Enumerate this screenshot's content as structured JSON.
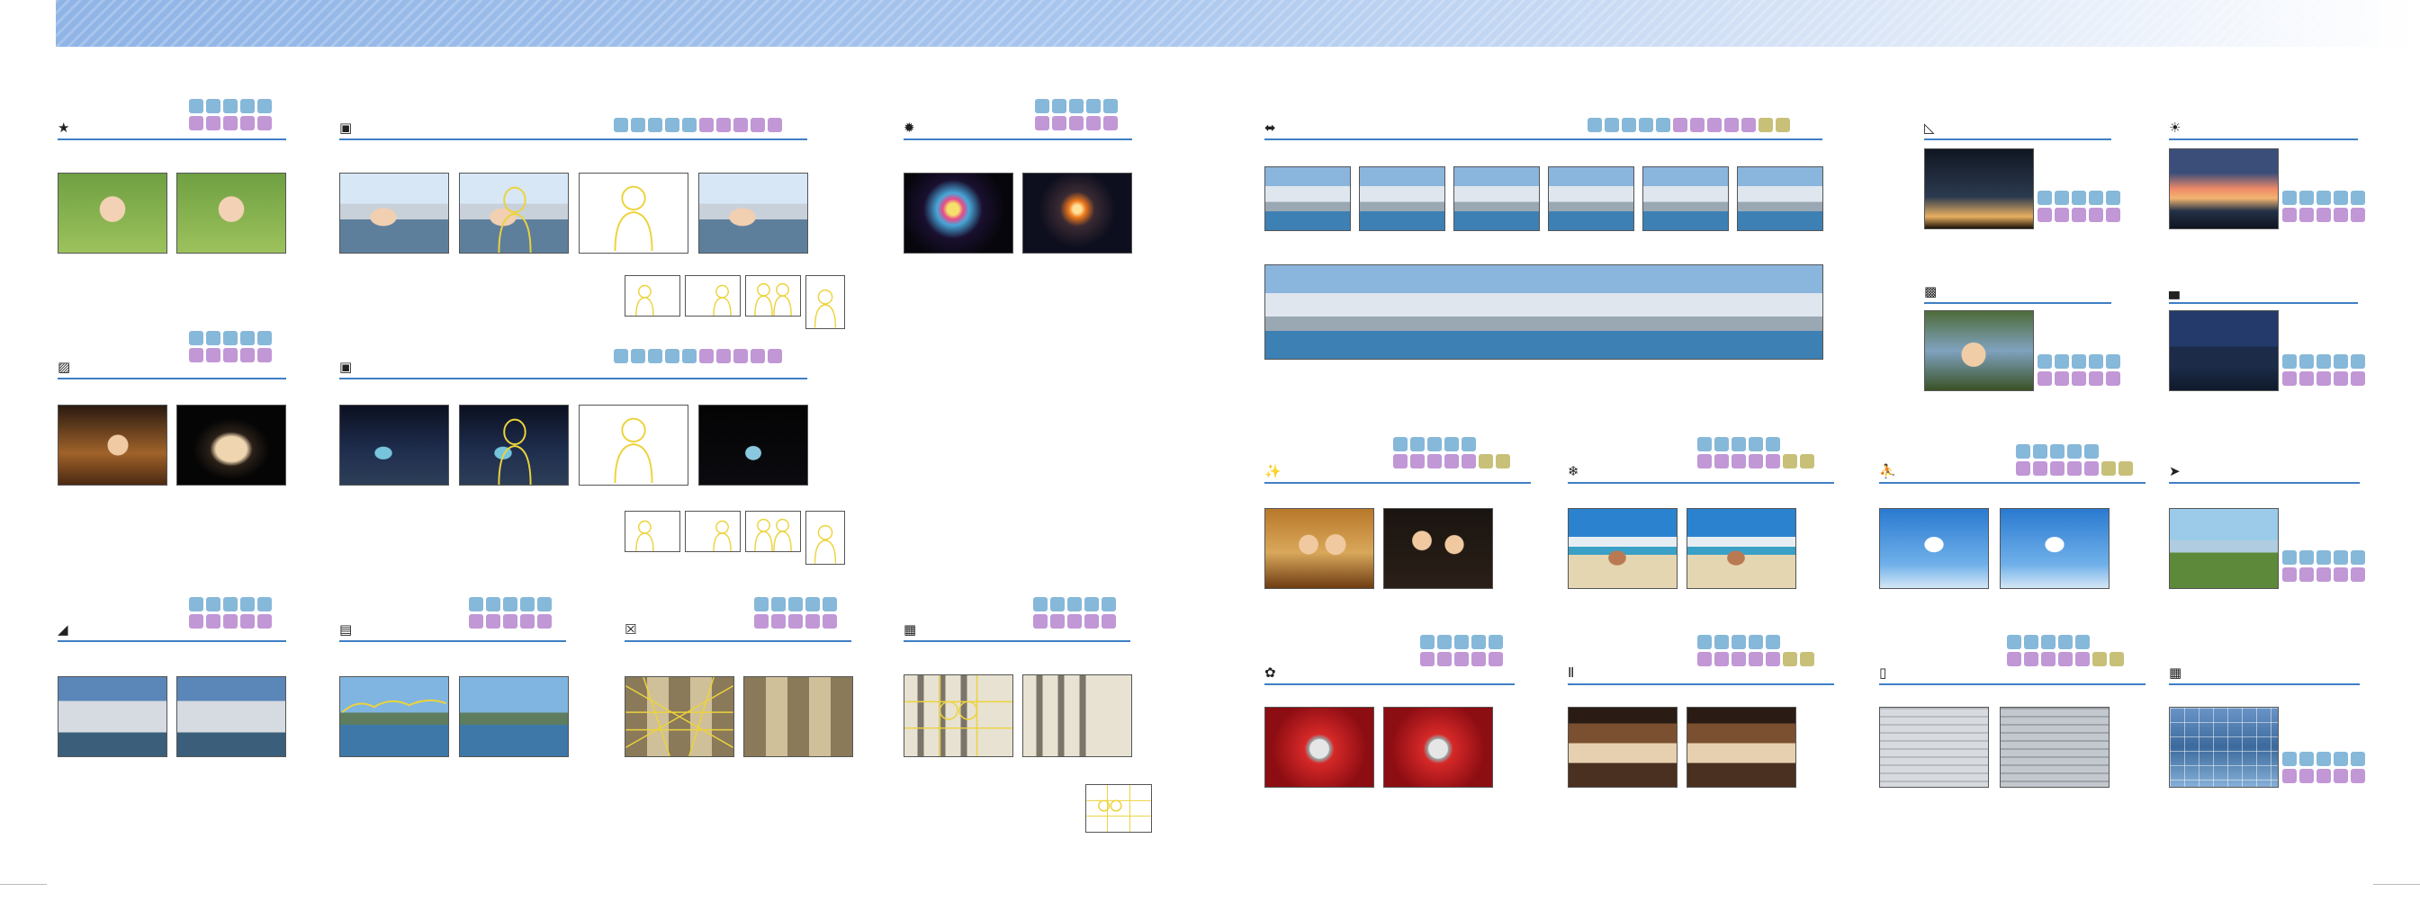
{
  "colors": {
    "accent": "#3f7fc4",
    "blue": "#86b8d9",
    "purple": "#c197d6",
    "olive": "#c8c078",
    "outline": "#ecd33c"
  },
  "icons": {
    "s1": "child-running-icon",
    "s2": "portrait-camera-icon",
    "s3": "fireworks-icon",
    "s4": "night-portrait-icon",
    "s5": "night-portrait-tripod-icon",
    "s6": "landscape-icon",
    "s7": "horizon-icon",
    "s8": "architecture-icon",
    "s9": "group-photo-icon",
    "s10": "panorama-icon",
    "s11": "night-landscape-icon",
    "s12": "sunset-icon",
    "s13": "backlight-icon",
    "s14": "dusk-icon",
    "s15": "party-icon",
    "s16": "beach-snow-icon",
    "s17": "sports-icon",
    "s18": "sports-action-icon",
    "s19": "close-up-icon",
    "s20": "museum-icon",
    "s21": "copy-document-icon",
    "s22": "multi-frame-icon"
  }
}
